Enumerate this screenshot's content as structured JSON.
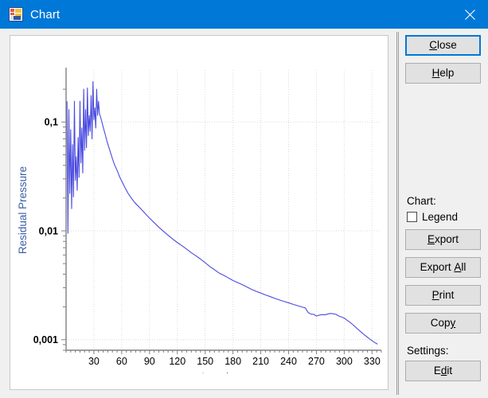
{
  "window": {
    "title": "Chart",
    "icon": "chart-icon",
    "close_label": "✕",
    "titlebar_color": "#0078d7",
    "background_color": "#f0f0f0"
  },
  "side_panel": {
    "close_button": {
      "label": "Close",
      "mnemonic": "C",
      "focused": true
    },
    "help_button": {
      "label": "Help",
      "mnemonic": "H"
    },
    "chart_group_label": "Chart:",
    "legend_checkbox": {
      "label": "Legend",
      "checked": false
    },
    "export_button": {
      "label": "Export",
      "mnemonic": "E"
    },
    "export_all_button": {
      "label": "Export All",
      "mnemonic": "A"
    },
    "print_button": {
      "label": "Print",
      "mnemonic": "P"
    },
    "copy_button": {
      "label": "Copy",
      "mnemonic": "y"
    },
    "settings_group_label": "Settings:",
    "edit_button": {
      "label": "Edit",
      "mnemonic": "d"
    }
  },
  "chart_data": {
    "type": "line",
    "title": "Residual Pressure",
    "xlabel": "Iterations",
    "ylabel": "Residual Pressure",
    "yscale": "log",
    "xlim": [
      0,
      340
    ],
    "ylim": [
      0.0008,
      0.3
    ],
    "grid": true,
    "legend": false,
    "legend_position": "none",
    "title_color": "#2b3f86",
    "axis_label_color": "#3c5fa8",
    "series_color": "#4a4ae0",
    "xticks": [
      30,
      60,
      90,
      120,
      150,
      180,
      210,
      240,
      270,
      300,
      330
    ],
    "xtick_labels": [
      "30",
      "60",
      "90",
      "120",
      "150",
      "180",
      "210",
      "240",
      "270",
      "300",
      "330"
    ],
    "xtick_minor_step": 5,
    "yticks": [
      0.1,
      0.01,
      0.001
    ],
    "ytick_labels": [
      "0,1",
      "0,01",
      "0,001"
    ],
    "series": [
      {
        "name": "Residual Pressure",
        "x": [
          1,
          2,
          3,
          4,
          5,
          6,
          7,
          8,
          9,
          10,
          11,
          12,
          13,
          14,
          15,
          16,
          17,
          18,
          19,
          20,
          21,
          22,
          23,
          24,
          25,
          26,
          27,
          28,
          29,
          30,
          31,
          32,
          33,
          34,
          35,
          36,
          38,
          40,
          42,
          44,
          46,
          48,
          50,
          52,
          55,
          58,
          61,
          64,
          67,
          70,
          74,
          78,
          82,
          86,
          90,
          95,
          100,
          105,
          110,
          115,
          120,
          125,
          130,
          135,
          140,
          145,
          150,
          155,
          160,
          165,
          170,
          175,
          180,
          185,
          190,
          195,
          200,
          205,
          210,
          215,
          220,
          225,
          230,
          235,
          240,
          245,
          250,
          255,
          258,
          261,
          264,
          267,
          270,
          273,
          276,
          279,
          282,
          285,
          288,
          291,
          294,
          297,
          300,
          303,
          306,
          309,
          312,
          315,
          318,
          321,
          324,
          327,
          330,
          333,
          336,
          338
        ],
        "y": [
          0.155,
          0.0095,
          0.13,
          0.022,
          0.085,
          0.016,
          0.062,
          0.0205,
          0.155,
          0.029,
          0.048,
          0.0235,
          0.072,
          0.031,
          0.155,
          0.042,
          0.088,
          0.034,
          0.2,
          0.055,
          0.13,
          0.058,
          0.205,
          0.075,
          0.115,
          0.082,
          0.175,
          0.07,
          0.235,
          0.105,
          0.135,
          0.088,
          0.2,
          0.115,
          0.155,
          0.12,
          0.105,
          0.09,
          0.078,
          0.067,
          0.059,
          0.052,
          0.046,
          0.041,
          0.036,
          0.031,
          0.0275,
          0.0245,
          0.022,
          0.0202,
          0.0182,
          0.0168,
          0.0155,
          0.0142,
          0.0131,
          0.0119,
          0.0108,
          0.0099,
          0.0091,
          0.0084,
          0.0078,
          0.0073,
          0.0068,
          0.0063,
          0.0059,
          0.0055,
          0.0051,
          0.0047,
          0.0044,
          0.0041,
          0.0039,
          0.0037,
          0.0035,
          0.00335,
          0.0032,
          0.00305,
          0.0029,
          0.00278,
          0.00268,
          0.00258,
          0.00249,
          0.0024,
          0.00232,
          0.00225,
          0.00218,
          0.00211,
          0.00205,
          0.00199,
          0.00196,
          0.00178,
          0.00172,
          0.00171,
          0.00165,
          0.00168,
          0.0017,
          0.00169,
          0.00172,
          0.00174,
          0.00173,
          0.00171,
          0.00165,
          0.00162,
          0.00158,
          0.00151,
          0.00145,
          0.00138,
          0.00131,
          0.00124,
          0.00118,
          0.00112,
          0.00107,
          0.00102,
          0.00098,
          0.00094,
          0.00091
        ]
      }
    ]
  }
}
